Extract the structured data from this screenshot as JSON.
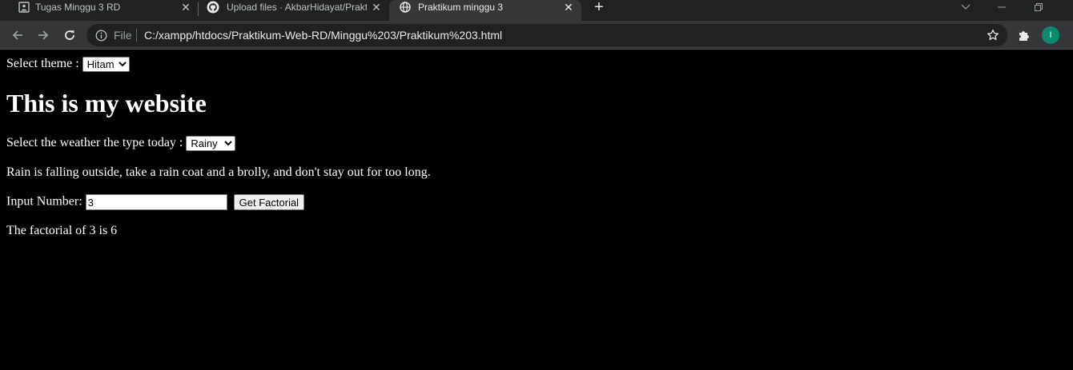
{
  "tabs": [
    {
      "title": "Tugas Minggu 3 RD",
      "favicon": "page-image-icon",
      "active": false
    },
    {
      "title": "Upload files · AkbarHidayat/Prakt",
      "favicon": "github-icon",
      "active": false
    },
    {
      "title": "Praktikum minggu 3",
      "favicon": "globe-icon",
      "active": true
    }
  ],
  "new_tab_label": "+",
  "address_bar": {
    "scheme_label": "File",
    "url": "C:/xampp/htdocs/Praktikum-Web-RD/Minggu%203/Praktikum%203.html"
  },
  "profile": {
    "initial": "I",
    "color": "#0d8a6e"
  },
  "page": {
    "theme_label": "Select theme :",
    "theme_options": [
      "Hitam"
    ],
    "theme_selected": "Hitam",
    "heading": "This is my website",
    "weather_label": "Select the weather the type today :",
    "weather_options": [
      "Rainy"
    ],
    "weather_selected": "Rainy",
    "weather_message": "Rain is falling outside, take a rain coat and a brolly, and don't stay out for too long.",
    "number_label": "Input Number:",
    "number_value": "3",
    "factorial_button": "Get Factorial",
    "factorial_result": "The factorial of 3 is 6"
  },
  "colors": {
    "tabbar_bg": "#202124",
    "toolbar_bg": "#35363a",
    "page_bg": "#000000",
    "page_text": "#ffffff"
  }
}
